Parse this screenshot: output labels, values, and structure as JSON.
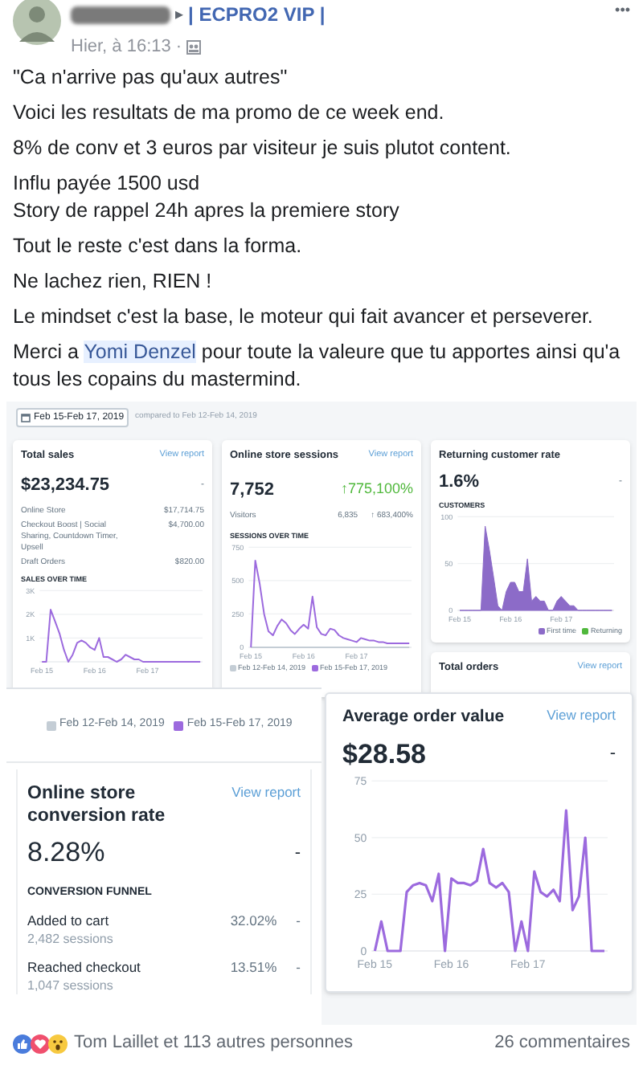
{
  "post": {
    "author_suffix": "| ECPRO2 VIP |",
    "separator": "▸",
    "time": "Hier, à 16:13 ·",
    "menu": "•••",
    "paragraphs": [
      {
        "text": "\"Ca n'arrive pas qu'aux autres\""
      },
      {
        "text": "Voici les resultats de ma promo de ce week end."
      },
      {
        "text": "8% de conv et 3 euros par visiteur je suis plutot content."
      },
      {
        "text": "Influ payée 1500 usd\nStory de rappel 24h apres la premiere story"
      },
      {
        "text": "Tout le reste c'est dans la forma."
      },
      {
        "text": "Ne lachez rien, RIEN !"
      },
      {
        "text": "Le mindset c'est la base, le moteur qui fait avancer et perseverer."
      },
      {
        "before": "Merci a ",
        "link": "Yomi Denzel",
        "after": " pour toute la valeure que tu apportes ainsi qu'a tous les copains du mastermind."
      }
    ]
  },
  "dashboard": {
    "date_range": "Feb 15-Feb 17, 2019",
    "compared": "compared to Feb 12-Feb 14, 2019",
    "total_sales": {
      "title": "Total sales",
      "link": "View report",
      "value": "$23,234.75",
      "change": "-",
      "breakdown": [
        {
          "label": "Online Store",
          "value": "$17,714.75"
        },
        {
          "label": "Checkout Boost | Social Sharing, Countdown Timer, Upsell",
          "value": "$4,700.00"
        },
        {
          "label": "Draft Orders",
          "value": "$820.00"
        }
      ],
      "chart_title": "SALES OVER TIME",
      "chart_data": {
        "type": "line",
        "categories": [
          "Feb 15",
          null,
          null,
          null,
          null,
          null,
          null,
          null,
          null,
          null,
          null,
          null,
          "Feb 16",
          null,
          null,
          null,
          null,
          null,
          null,
          null,
          null,
          null,
          null,
          null,
          "Feb 17",
          null,
          null,
          null,
          null,
          null,
          null,
          null,
          null,
          null,
          null,
          null,
          null
        ],
        "ylim": [
          0,
          3000
        ],
        "yticks": [
          {
            "value": 1000,
            "label": "1K"
          },
          {
            "value": 2000,
            "label": "2K"
          },
          {
            "value": 3000,
            "label": "3K"
          }
        ],
        "series": [
          {
            "color": "#9c6ade",
            "values": [
              0,
              0,
              2200,
              1700,
              1200,
              500,
              0,
              300,
              800,
              900,
              800,
              600,
              500,
              1000,
              200,
              200,
              100,
              0,
              100,
              300,
              200,
              100,
              100,
              0,
              0,
              0,
              0,
              0,
              0,
              0,
              0,
              0,
              0,
              0,
              0,
              0,
              0
            ]
          }
        ]
      }
    },
    "sessions": {
      "title": "Online store sessions",
      "link": "View report",
      "value": "7,752",
      "change": "↑775,100%",
      "visitors_label": "Visitors",
      "visitors": "6,835",
      "visitors_change": "↑ 683,400%",
      "chart_title": "SESSIONS OVER TIME",
      "chart_data": {
        "type": "line",
        "categories": [
          "Feb 15",
          null,
          null,
          null,
          null,
          null,
          null,
          null,
          null,
          null,
          null,
          null,
          "Feb 16",
          null,
          null,
          null,
          null,
          null,
          null,
          null,
          null,
          null,
          null,
          null,
          "Feb 17",
          null,
          null,
          null,
          null,
          null,
          null,
          null,
          null,
          null,
          null,
          null,
          null
        ],
        "ylim": [
          0,
          750
        ],
        "yticks": [
          0,
          250,
          500,
          750
        ],
        "series": [
          {
            "name": "Feb 12-Feb 14, 2019",
            "color": "#c4cdd5",
            "values": [
              0,
              0,
              0,
              0,
              0,
              0,
              0,
              0,
              0,
              0,
              0,
              0,
              0,
              0,
              0,
              0,
              0,
              0,
              0,
              0,
              0,
              0,
              0,
              0,
              0,
              0,
              0,
              0,
              0,
              0,
              0,
              0,
              0,
              0,
              0,
              0,
              0
            ]
          },
          {
            "name": "Feb 15-Feb 17, 2019",
            "color": "#9c6ade",
            "values": [
              0,
              650,
              480,
              250,
              120,
              90,
              160,
              210,
              180,
              130,
              100,
              140,
              170,
              140,
              380,
              150,
              100,
              90,
              140,
              130,
              90,
              70,
              60,
              50,
              40,
              70,
              60,
              50,
              50,
              40,
              40,
              30,
              30,
              30,
              30,
              30,
              30
            ]
          }
        ]
      }
    },
    "returning": {
      "title": "Returning customer rate",
      "value": "1.6%",
      "change": "-",
      "chart_title": "CUSTOMERS",
      "chart_data": {
        "type": "area",
        "categories": [
          "Feb 15",
          null,
          null,
          null,
          null,
          null,
          null,
          null,
          null,
          null,
          null,
          null,
          "Feb 16",
          null,
          null,
          null,
          null,
          null,
          null,
          null,
          null,
          null,
          null,
          null,
          "Feb 17",
          null,
          null,
          null,
          null,
          null,
          null,
          null,
          null,
          null,
          null,
          null,
          null
        ],
        "ylim": [
          0,
          100
        ],
        "yticks": [
          0,
          50,
          100
        ],
        "series": [
          {
            "name": "First time",
            "color": "#8c6bc8",
            "values": [
              0,
              0,
              0,
              0,
              0,
              0,
              90,
              65,
              35,
              5,
              0,
              20,
              30,
              30,
              20,
              20,
              55,
              10,
              15,
              10,
              10,
              0,
              0,
              10,
              15,
              10,
              5,
              5,
              0,
              0,
              0,
              0,
              0,
              0,
              0,
              0,
              0
            ]
          },
          {
            "name": "Returning",
            "color": "#50b83c",
            "values": [
              null,
              null,
              null,
              null,
              null,
              null,
              null,
              null,
              null,
              null,
              null,
              null,
              null,
              null,
              null,
              null,
              null,
              null,
              null,
              null,
              null,
              null,
              null,
              null,
              null,
              null,
              null,
              null,
              null,
              null,
              null,
              null,
              null,
              null,
              null,
              null,
              null
            ]
          }
        ]
      }
    },
    "total_orders": {
      "title": "Total orders",
      "link": "View report"
    },
    "overlay_legend": [
      {
        "label": "Feb 12-Feb 14, 2019",
        "color": "#c4cdd5"
      },
      {
        "label": "Feb 15-Feb 17, 2019",
        "color": "#9c6ade"
      }
    ],
    "conversion": {
      "title": "Online store conversion rate",
      "link": "View report",
      "value": "8.28%",
      "change": "-",
      "funnel_title": "CONVERSION FUNNEL",
      "funnel": [
        {
          "label": "Added to cart",
          "value": "32.02%",
          "change": "-",
          "sessions": "2,482 sessions"
        },
        {
          "label": "Reached checkout",
          "value": "13.51%",
          "change": "-",
          "sessions": "1,047 sessions"
        }
      ]
    },
    "aov": {
      "title": "Average order value",
      "link": "View report",
      "value": "$28.58",
      "change": "-",
      "chart_data": {
        "type": "line",
        "categories": [
          "Feb 15",
          null,
          null,
          null,
          null,
          null,
          null,
          null,
          null,
          null,
          null,
          null,
          "Feb 16",
          null,
          null,
          null,
          null,
          null,
          null,
          null,
          null,
          null,
          null,
          null,
          "Feb 17",
          null,
          null,
          null,
          null,
          null,
          null,
          null,
          null,
          null,
          null,
          null,
          null
        ],
        "ylim": [
          0,
          75
        ],
        "yticks": [
          0,
          25,
          50,
          75
        ],
        "series": [
          {
            "color": "#9c6ade",
            "values": [
              0,
              13,
              0,
              0,
              0,
              26,
              29,
              30,
              29,
              22,
              34,
              0,
              32,
              30,
              30,
              29,
              31,
              45,
              30,
              28,
              30,
              26,
              0,
              13,
              0,
              35,
              26,
              24,
              27,
              22,
              62,
              18,
              24,
              50,
              0,
              0,
              0
            ]
          }
        ]
      }
    }
  },
  "reactions": {
    "summary": "Tom Laillet et 113 autres personnes",
    "comments": "26 commentaires"
  }
}
